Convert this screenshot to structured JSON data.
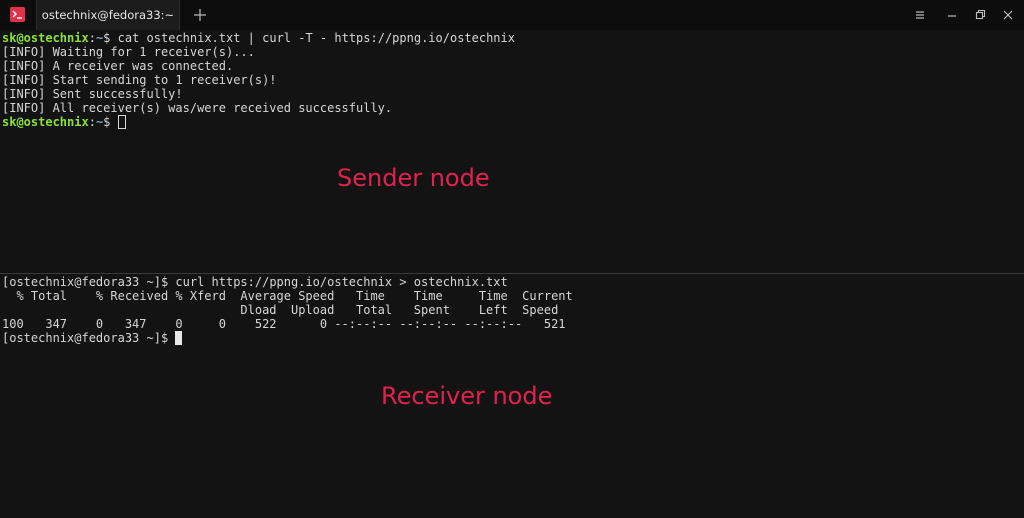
{
  "window": {
    "tab_title": "ostechnix@fedora33:~",
    "app_icon_glyph": ">_"
  },
  "colors": {
    "background": "#131313",
    "prompt_user": "#8ae234",
    "prompt_path": "#729fcf",
    "label": "#e0234e",
    "app_icon": "#e0324b"
  },
  "sender": {
    "prompt_user": "sk@ostechnix",
    "prompt_sep": ":",
    "prompt_path": "~",
    "prompt_end": "$",
    "command": " cat ostechnix.txt | curl -T - https://ppng.io/ostechnix",
    "output": [
      "[INFO] Waiting for 1 receiver(s)...",
      "[INFO] A receiver was connected.",
      "[INFO] Start sending to 1 receiver(s)!",
      "[INFO] Sent successfully!",
      "[INFO] All receiver(s) was/were received successfully."
    ],
    "label": "Sender node"
  },
  "receiver": {
    "prompt": "[ostechnix@fedora33 ~]$",
    "command": " curl https://ppng.io/ostechnix > ostechnix.txt",
    "progress_header_1": "  % Total    % Received % Xferd  Average Speed   Time    Time     Time  Current",
    "progress_header_2": "                                 Dload  Upload   Total   Spent    Left  Speed",
    "progress_row": "100   347    0   347    0     0    522      0 --:--:-- --:--:-- --:--:--   521",
    "label": "Receiver node"
  }
}
